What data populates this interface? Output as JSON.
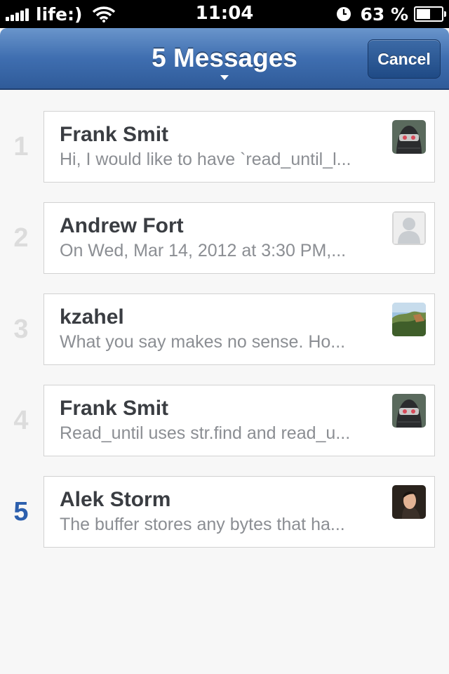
{
  "status_bar": {
    "carrier": "life:)",
    "time": "11:04",
    "battery_percent": "63 %",
    "battery_level": 0.63,
    "signal_bars": 5
  },
  "nav": {
    "title": "5 Messages",
    "cancel_label": "Cancel"
  },
  "colors": {
    "nav_blue": "#3f6eb0",
    "active_index": "#2c5fad",
    "inactive_index": "#dcdcdc"
  },
  "messages": [
    {
      "index": "1",
      "sender": "Frank Smit",
      "preview": "Hi, I would like to have `read_until_l...",
      "avatar": "ninja-avatar-icon",
      "active": false
    },
    {
      "index": "2",
      "sender": "Andrew Fort",
      "preview": "On Wed, Mar 14, 2012 at 3:30 PM,...",
      "avatar": "default-person-avatar-icon",
      "active": false
    },
    {
      "index": "3",
      "sender": "kzahel",
      "preview": "What you say makes no sense. Ho...",
      "avatar": "landscape-avatar-icon",
      "active": false
    },
    {
      "index": "4",
      "sender": "Frank Smit",
      "preview": "Read_until uses str.find and read_u...",
      "avatar": "ninja-avatar-icon",
      "active": false
    },
    {
      "index": "5",
      "sender": "Alek Storm",
      "preview": "The buffer stores any bytes that ha...",
      "avatar": "photo-avatar-icon",
      "active": true
    }
  ]
}
